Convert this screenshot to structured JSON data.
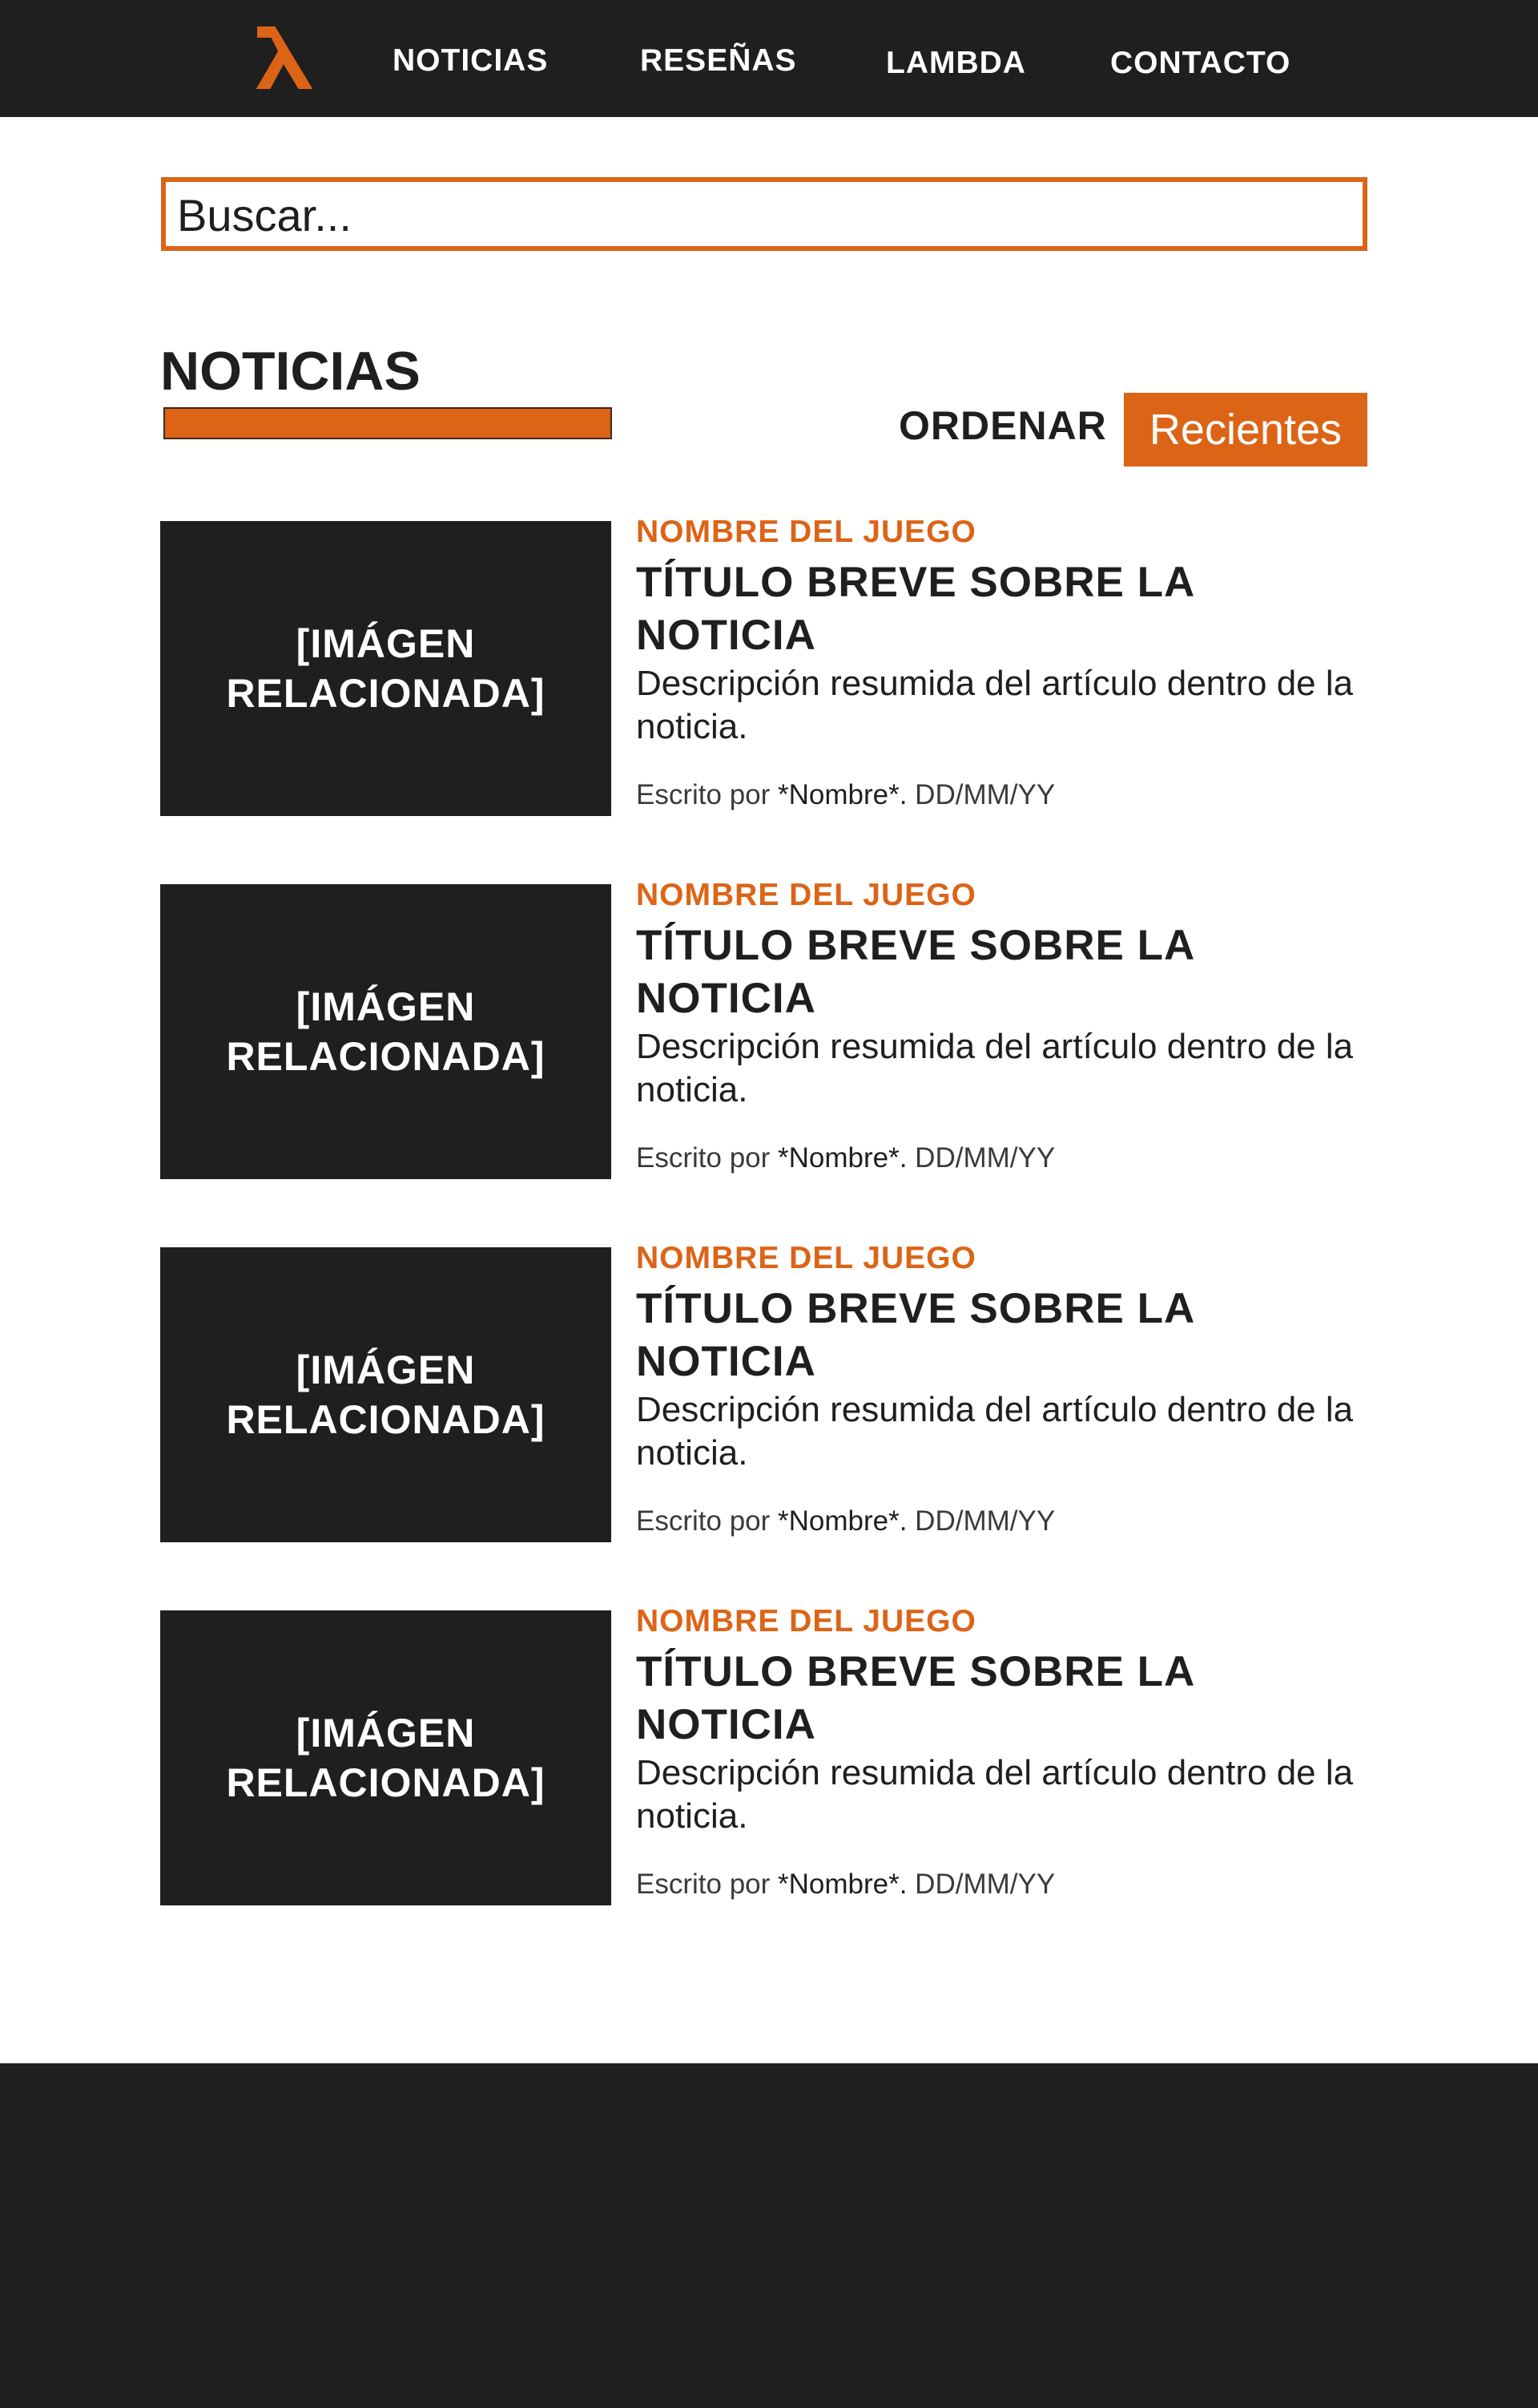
{
  "brand": {
    "logo_icon": "lambda-icon",
    "accent_color": "#dc6417",
    "dark_color": "#1f1f1f"
  },
  "nav": {
    "items": [
      {
        "label": "NOTICIAS"
      },
      {
        "label": "RESEÑAS"
      },
      {
        "label": "LAMBDA"
      },
      {
        "label": "CONTACTO"
      }
    ]
  },
  "search": {
    "placeholder": "Buscar..."
  },
  "section": {
    "title": "NOTICIAS",
    "sort_label": "ORDENAR",
    "sort_value": "Recientes"
  },
  "articles": [
    {
      "image_label": "[IMÁGEN\nRELACIONADA]",
      "game": "NOMBRE DEL JUEGO",
      "title": "TÍTULO BREVE SOBRE LA NOTICIA",
      "description": "Descripción resumida del artículo dentro de la noticia.",
      "byline_prefix": "Escrito por ",
      "author": "*Nombre*.",
      "date": " DD/MM/YY"
    },
    {
      "image_label": "[IMÁGEN\nRELACIONADA]",
      "game": "NOMBRE DEL JUEGO",
      "title": "TÍTULO BREVE SOBRE LA NOTICIA",
      "description": "Descripción resumida del artículo dentro de la noticia.",
      "byline_prefix": "Escrito por ",
      "author": "*Nombre*.",
      "date": " DD/MM/YY"
    },
    {
      "image_label": "[IMÁGEN\nRELACIONADA]",
      "game": "NOMBRE DEL JUEGO",
      "title": "TÍTULO BREVE SOBRE LA NOTICIA",
      "description": "Descripción resumida del artículo dentro de la noticia.",
      "byline_prefix": "Escrito por ",
      "author": "*Nombre*.",
      "date": " DD/MM/YY"
    },
    {
      "image_label": "[IMÁGEN\nRELACIONADA]",
      "game": "NOMBRE DEL JUEGO",
      "title": "TÍTULO BREVE SOBRE LA NOTICIA",
      "description": "Descripción resumida del artículo dentro de la noticia.",
      "byline_prefix": "Escrito por ",
      "author": "*Nombre*.",
      "date": " DD/MM/YY"
    }
  ]
}
